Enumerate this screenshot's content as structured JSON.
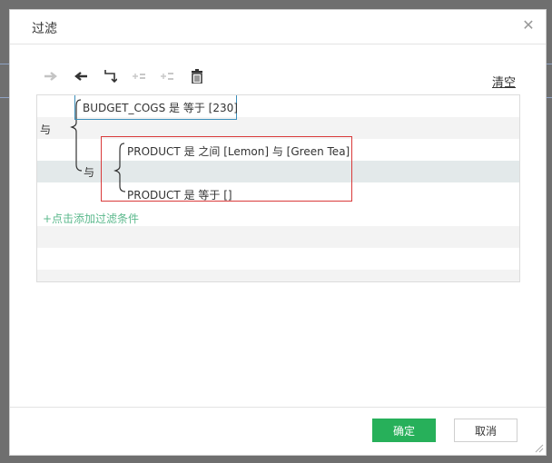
{
  "dialog": {
    "title": "过滤",
    "close_icon": "close-icon"
  },
  "toolbar": {
    "icons": [
      "arrow-right-icon",
      "arrow-left-icon",
      "wrap-arrow-icon",
      "add-condition-icon",
      "add-group-icon",
      "trash-icon"
    ],
    "clear_label": "清空"
  },
  "filters": {
    "root_operator": "与",
    "condition_1": "BUDGET_COGS 是 等于 [230]",
    "group_operator": "与",
    "group_condition_1": "PRODUCT 是 之间 [Lemon] 与 [Green Tea]",
    "group_condition_2": "PRODUCT 是 等于 []",
    "add_label": "+点击添加过滤条件"
  },
  "footer": {
    "ok_label": "确定",
    "cancel_label": "取消"
  },
  "colors": {
    "ok_button": "#27b05a",
    "selection_box": "#d93a3a",
    "focus_box": "#3d8fba",
    "add_link": "#5cb98d"
  }
}
